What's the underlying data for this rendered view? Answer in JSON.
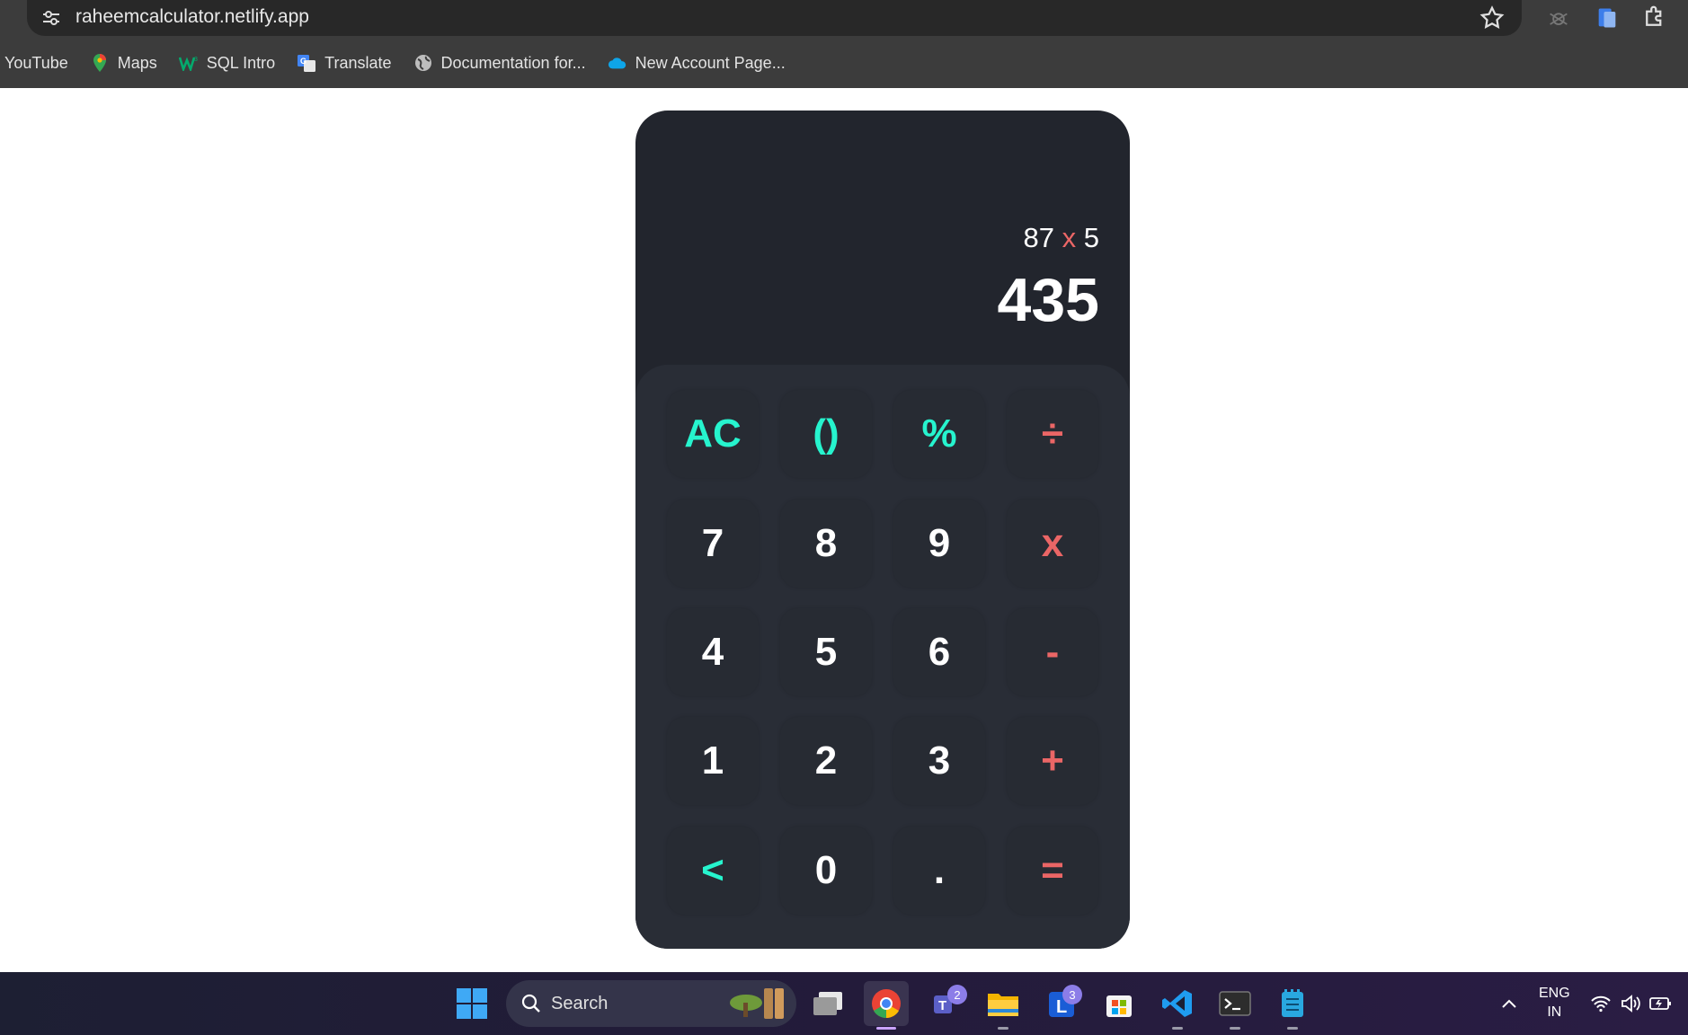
{
  "browser": {
    "url": "raheemcalculator.netlify.app",
    "bookmarks": [
      {
        "label": "YouTube",
        "icon": "youtube-icon"
      },
      {
        "label": "Maps",
        "icon": "maps-icon"
      },
      {
        "label": "SQL Intro",
        "icon": "w3schools-icon"
      },
      {
        "label": "Translate",
        "icon": "translate-icon"
      },
      {
        "label": "Documentation for...",
        "icon": "globe-icon"
      },
      {
        "label": "New Account Page...",
        "icon": "cloud-icon"
      }
    ]
  },
  "calculator": {
    "expression": {
      "left": "87",
      "operator": "x",
      "right": "5"
    },
    "result": "435",
    "keys": [
      [
        "AC",
        "()",
        "%",
        "÷"
      ],
      [
        "7",
        "8",
        "9",
        "x"
      ],
      [
        "4",
        "5",
        "6",
        "-"
      ],
      [
        "1",
        "2",
        "3",
        "+"
      ],
      [
        "<",
        "0",
        ".",
        "="
      ]
    ],
    "colors": {
      "teal": "#26f4ce",
      "red": "#eb6666",
      "body": "#22252d",
      "keypad": "#292d36"
    }
  },
  "taskbar": {
    "search_label": "Search",
    "teams_badge": "2",
    "l_app_badge": "3",
    "lang_line1": "ENG",
    "lang_line2": "IN"
  }
}
